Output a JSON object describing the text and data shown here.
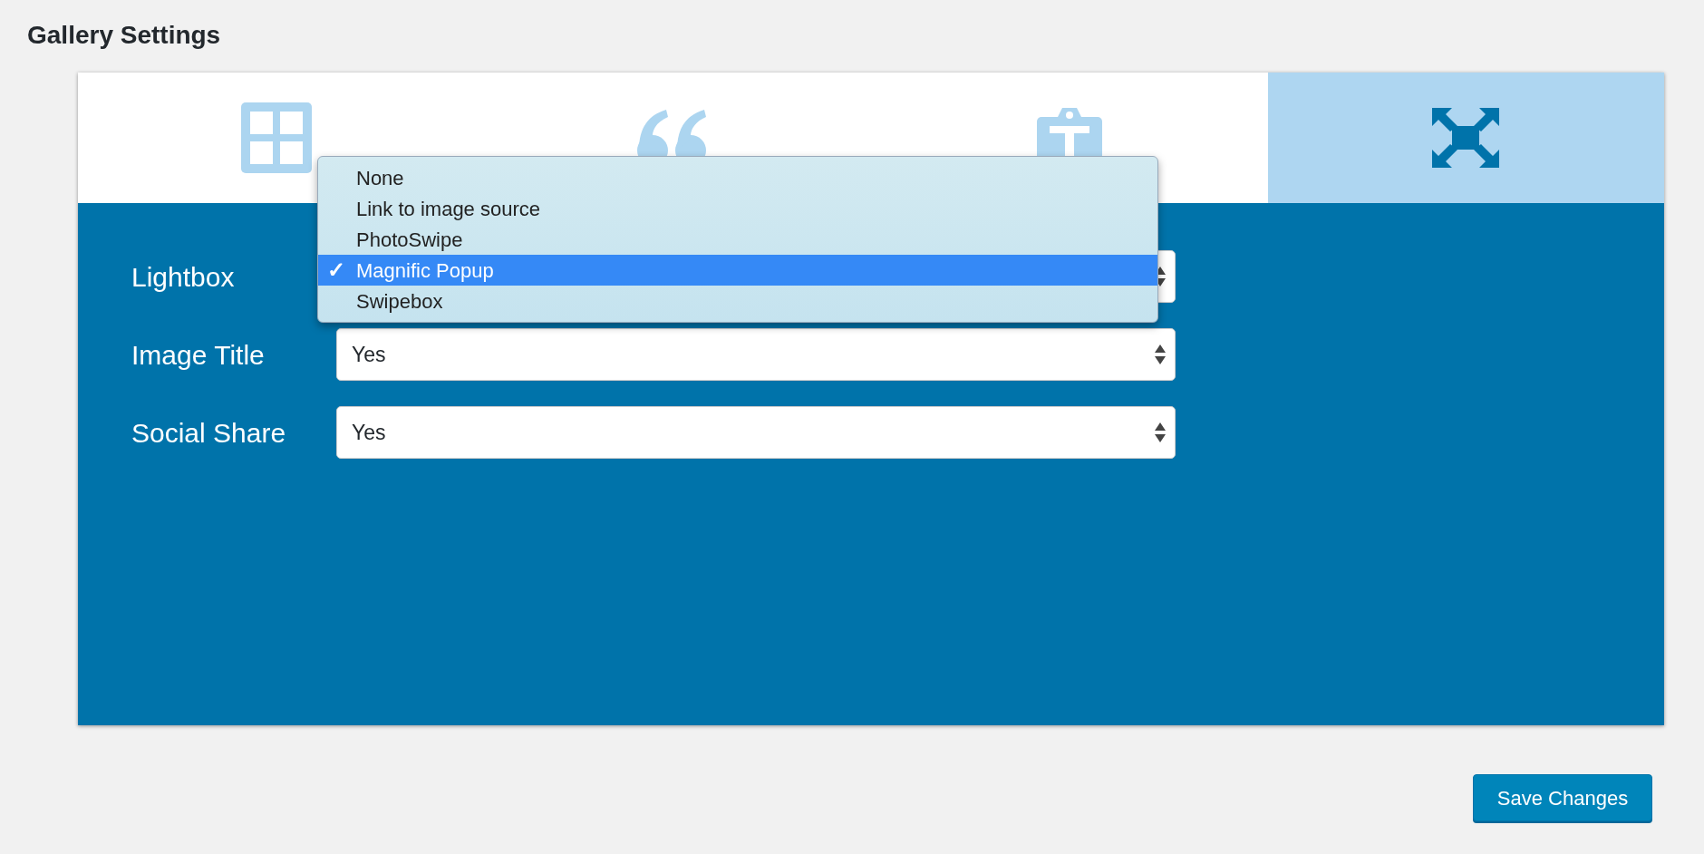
{
  "title": "Gallery Settings",
  "tabs": [
    {
      "kind": "grid",
      "selected": false
    },
    {
      "kind": "quote",
      "selected": false
    },
    {
      "kind": "clipboard",
      "selected": false
    },
    {
      "kind": "expand",
      "selected": true
    }
  ],
  "fields": [
    {
      "label": "Lightbox",
      "options": [
        {
          "label": "None",
          "selected": false
        },
        {
          "label": "Link to image source",
          "selected": false
        },
        {
          "label": "PhotoSwipe",
          "selected": false
        },
        {
          "label": "Magnific Popup",
          "selected": true
        },
        {
          "label": "Swipebox",
          "selected": false
        }
      ]
    },
    {
      "label": "Image Title",
      "value": "Yes"
    },
    {
      "label": "Social Share",
      "value": "Yes"
    }
  ],
  "check_mark": "✓",
  "save_button": "Save Changes"
}
